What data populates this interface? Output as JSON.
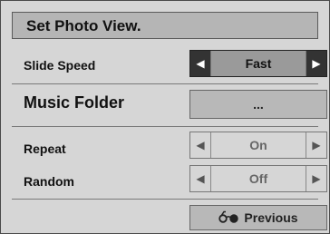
{
  "dialog": {
    "title": "Set Photo View."
  },
  "slide_speed": {
    "label": "Slide Speed",
    "value": "Fast"
  },
  "music_folder": {
    "label": "Music Folder",
    "button_label": "..."
  },
  "repeat": {
    "label": "Repeat",
    "value": "On"
  },
  "random": {
    "label": "Random",
    "value": "Off"
  },
  "footer": {
    "previous_label": "Previous"
  },
  "icons": {
    "left": "arrow-left-icon",
    "right": "arrow-right-icon",
    "previous": "glasses-icon"
  },
  "colors": {
    "active_selector_bg": "#333333",
    "panel_bg": "#d6d6d6",
    "title_bg": "#b5b5b5"
  }
}
